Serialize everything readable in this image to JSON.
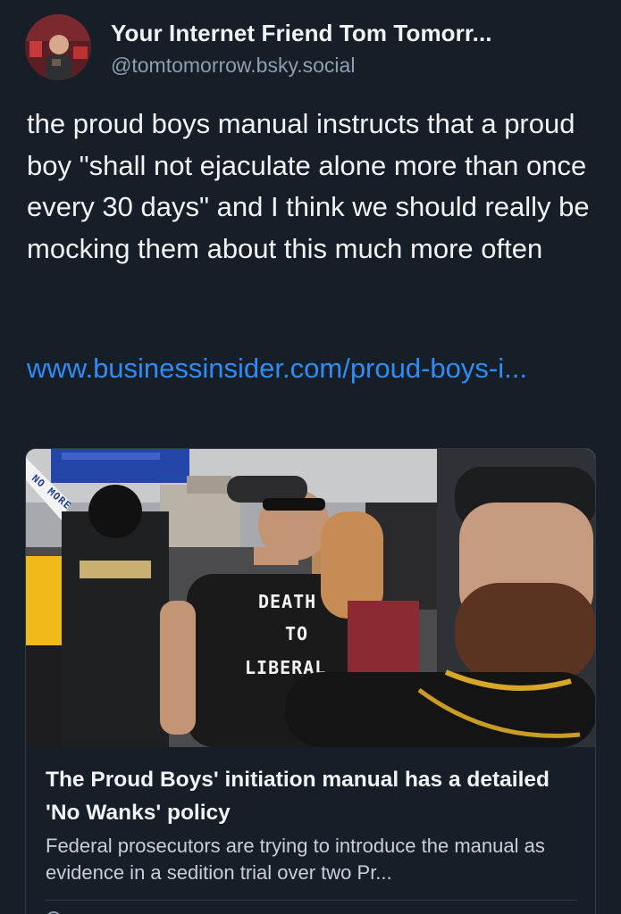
{
  "author": {
    "display_name": "Your Internet Friend Tom Tomorr...",
    "handle": "@tomtomorrow.bsky.social",
    "avatar_icon": "avatar-photo"
  },
  "post": {
    "text": "the proud boys manual instructs that a proud boy \"shall not ejaculate alone more than once every 30 days\" and I think we should really be mocking them about this much more often",
    "link_text": "www.businessinsider.com/proud-boys-i..."
  },
  "card": {
    "image_text": {
      "banner": "NO MORE",
      "shirt_line1": "DEATH",
      "shirt_line2": "TO",
      "shirt_line3": "LIBERAL"
    },
    "title": "The Proud Boys' initiation manual has a detailed 'No Wanks' policy",
    "description": "Federal prosecutors are trying to introduce the manual as evidence in a sedition trial over two Pr..."
  },
  "colors": {
    "background": "#161e27",
    "text": "#f1f3f5",
    "muted": "#8f9fb2",
    "link": "#2f8cf5",
    "border": "#2e3b4a"
  }
}
